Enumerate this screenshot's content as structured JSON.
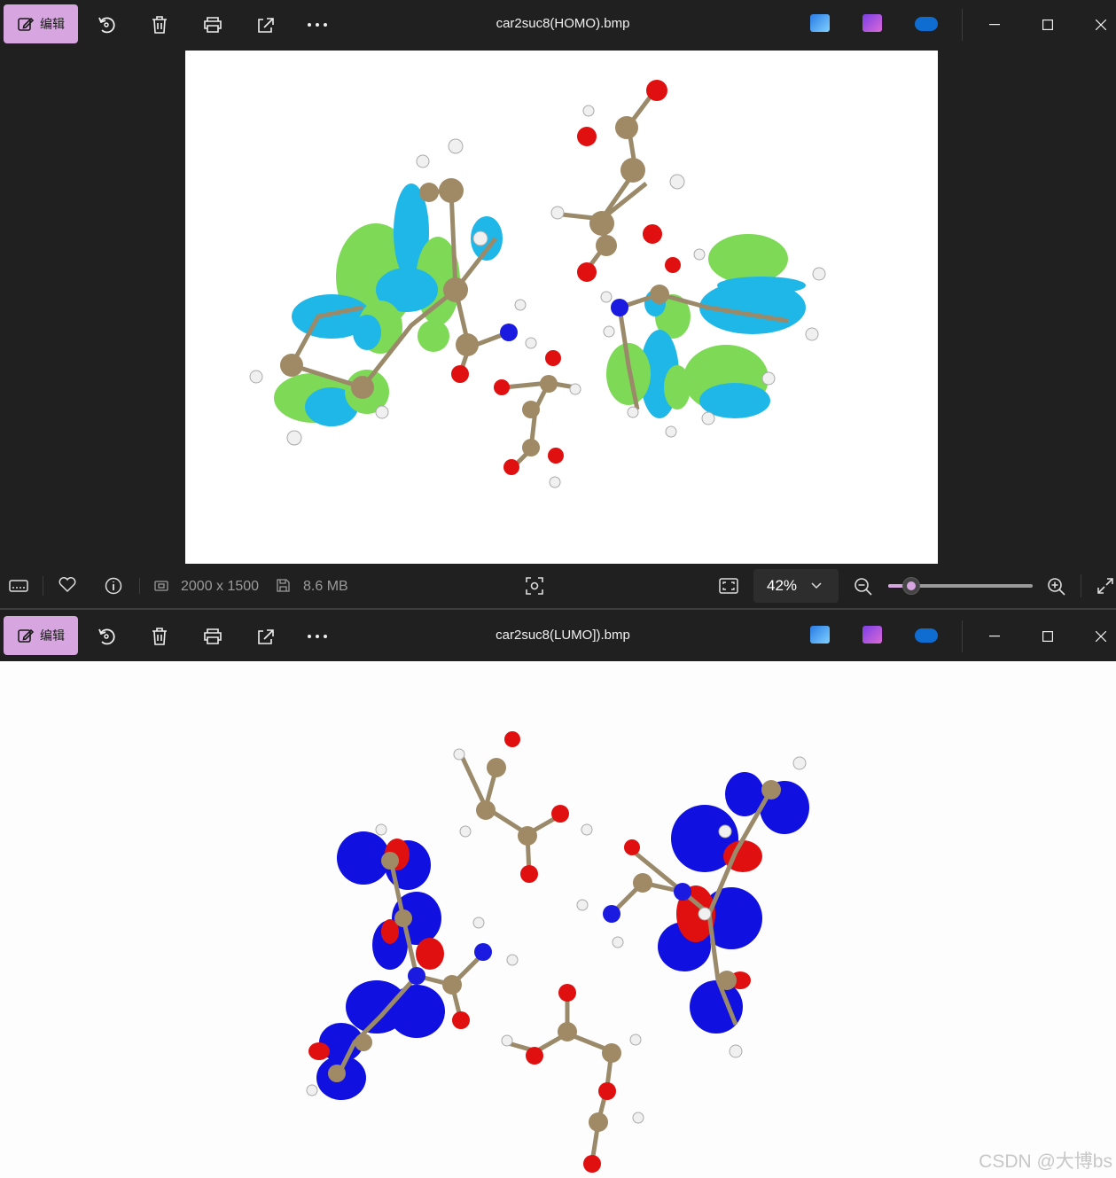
{
  "window1": {
    "edit_label": "编辑",
    "title": "car2suc8(HOMO).bmp"
  },
  "status": {
    "dimensions": "2000 x 1500",
    "filesize": "8.6 MB",
    "zoom": "42%",
    "zoom_slider_fraction": 0.1
  },
  "window2": {
    "edit_label": "编辑",
    "title": "car2suc8(LUMO]).bmp"
  },
  "icons": [
    "edit-icon",
    "rotate-icon",
    "delete-icon",
    "print-icon",
    "share-icon",
    "more-icon",
    "photos-editor-icon",
    "clipchamp-icon",
    "onedrive-icon",
    "minimize-icon",
    "maximize-icon",
    "close-icon",
    "filmstrip-icon",
    "favorite-icon",
    "info-icon",
    "dimensions-icon",
    "filesize-icon",
    "visual-search-icon",
    "fit-window-icon",
    "chevron-down-icon",
    "zoom-out-icon",
    "zoom-in-icon",
    "fullscreen-icon"
  ],
  "colors": {
    "accent": "#d7a6e0",
    "homo_positive": "#7ed957",
    "homo_negative": "#1fb6e8",
    "lumo_positive": "#1010e0",
    "lumo_negative": "#e01010"
  },
  "watermark": "CSDN @大博bs"
}
